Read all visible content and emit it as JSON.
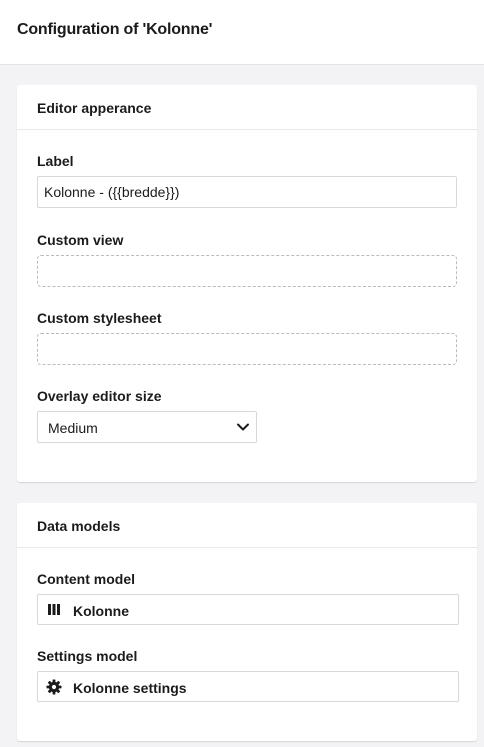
{
  "header": {
    "title": "Configuration of 'Kolonne'"
  },
  "editor_panel": {
    "title": "Editor apperance",
    "label_field": {
      "label": "Label",
      "value": "Kolonne - ({{bredde}})"
    },
    "custom_view": {
      "label": "Custom view"
    },
    "custom_stylesheet": {
      "label": "Custom stylesheet"
    },
    "overlay_size": {
      "label": "Overlay editor size",
      "selected": "Medium"
    }
  },
  "data_models_panel": {
    "title": "Data models",
    "content_model": {
      "label": "Content model",
      "name": "Kolonne",
      "icon": "columns-icon"
    },
    "settings_model": {
      "label": "Settings model",
      "name": "Kolonne settings",
      "icon": "gear-icon"
    }
  }
}
